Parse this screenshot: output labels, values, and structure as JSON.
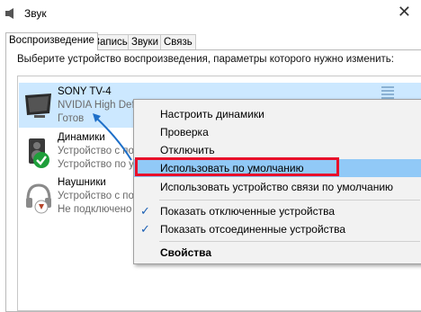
{
  "window": {
    "title": "Звук",
    "close_glyph": "✕"
  },
  "tabs": [
    {
      "label": "Воспроизведение",
      "active": true
    },
    {
      "label": "Запись",
      "active": false
    },
    {
      "label": "Звуки",
      "active": false
    },
    {
      "label": "Связь",
      "active": false
    }
  ],
  "instruction": "Выберите устройство воспроизведения, параметры которого нужно изменить:",
  "devices": [
    {
      "name": "SONY TV-4",
      "subtitle": "NVIDIA High Defin",
      "state": "Готов",
      "icon": "tv-icon",
      "selected": true
    },
    {
      "name": "Динамики",
      "subtitle": "Устройство с под",
      "state": "Устройство по у",
      "icon": "speaker-icon",
      "badge": "check-badge-icon"
    },
    {
      "name": "Наушники",
      "subtitle": "Устройство с под",
      "state": "Не подключено",
      "icon": "headphones-icon",
      "badge": "down-arrow-badge-icon"
    }
  ],
  "context_menu": {
    "items": [
      {
        "label": "Настроить динамики"
      },
      {
        "label": "Проверка"
      },
      {
        "label": "Отключить"
      },
      {
        "label": "Использовать по умолчанию",
        "hovered": true,
        "highlighted": true
      },
      {
        "label": "Использовать устройство связи по умолчанию"
      },
      {
        "label": "Показать отключенные устройства",
        "checked": true
      },
      {
        "label": "Показать отсоединенные устройства",
        "checked": true
      },
      {
        "label": "Свойства",
        "bold": true
      }
    ],
    "check_glyph": "✓"
  },
  "colors": {
    "selection": "#cce8ff",
    "menu_hover": "#91c9f7",
    "highlight_border": "#e8102a",
    "annotation_arrow": "#1e6fc8",
    "badge_green": "#1e9e3a",
    "badge_brown": "#b5452a"
  }
}
